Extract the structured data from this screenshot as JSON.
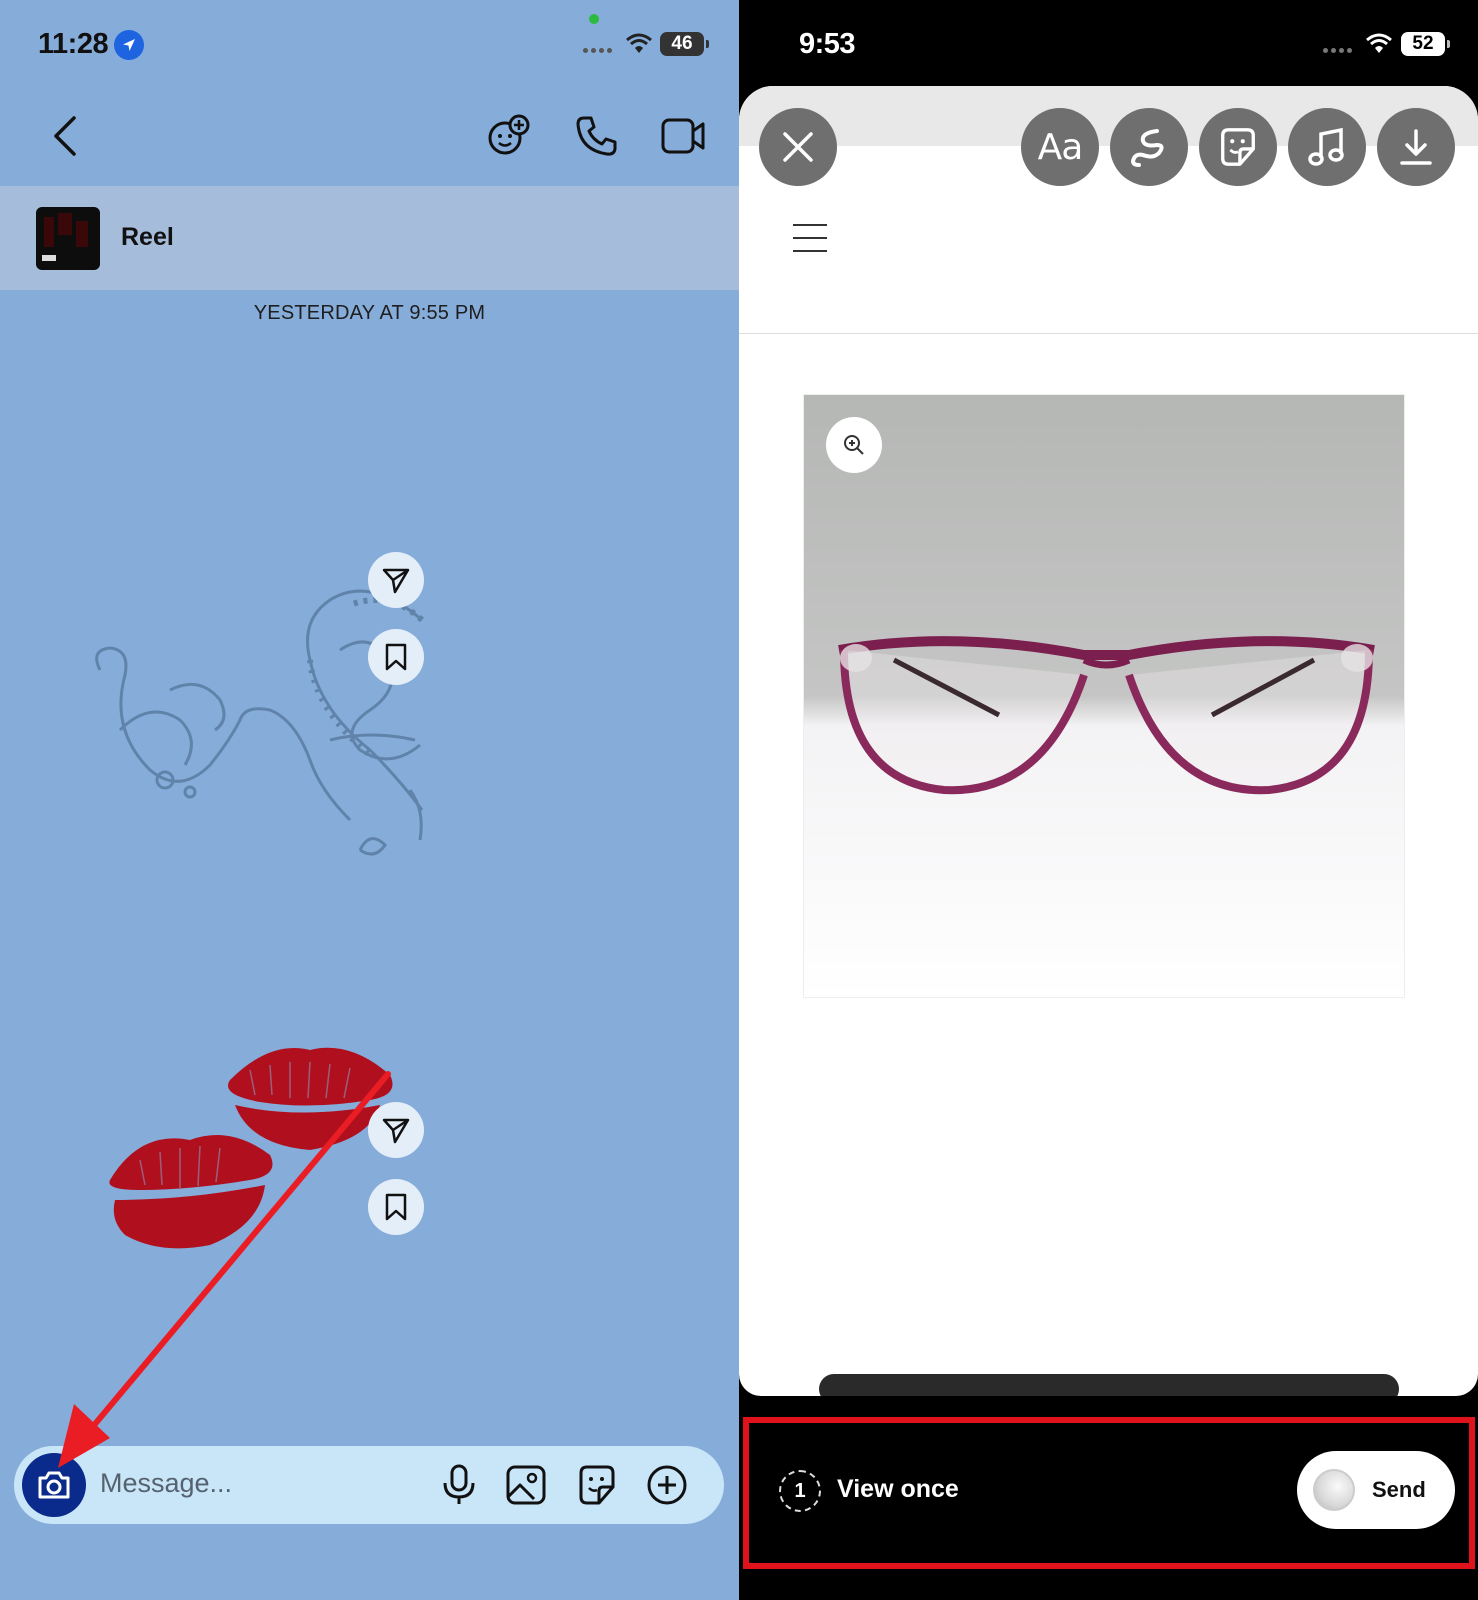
{
  "left": {
    "status": {
      "time": "11:28",
      "battery": "46"
    },
    "reel_label": "Reel",
    "timestamp": "YESTERDAY AT 9:55 PM",
    "composer": {
      "placeholder": "Message..."
    }
  },
  "right": {
    "status": {
      "time": "9:53",
      "battery": "52"
    },
    "tools": {
      "text_label": "Aa"
    },
    "bottom": {
      "view_once_count": "1",
      "view_once_label": "View once",
      "send_label": "Send"
    }
  },
  "colors": {
    "left_bg": "#86acd9",
    "camera_button": "#0a2a8c",
    "highlight": "#e0121b",
    "arrow": "#ea1d24"
  }
}
